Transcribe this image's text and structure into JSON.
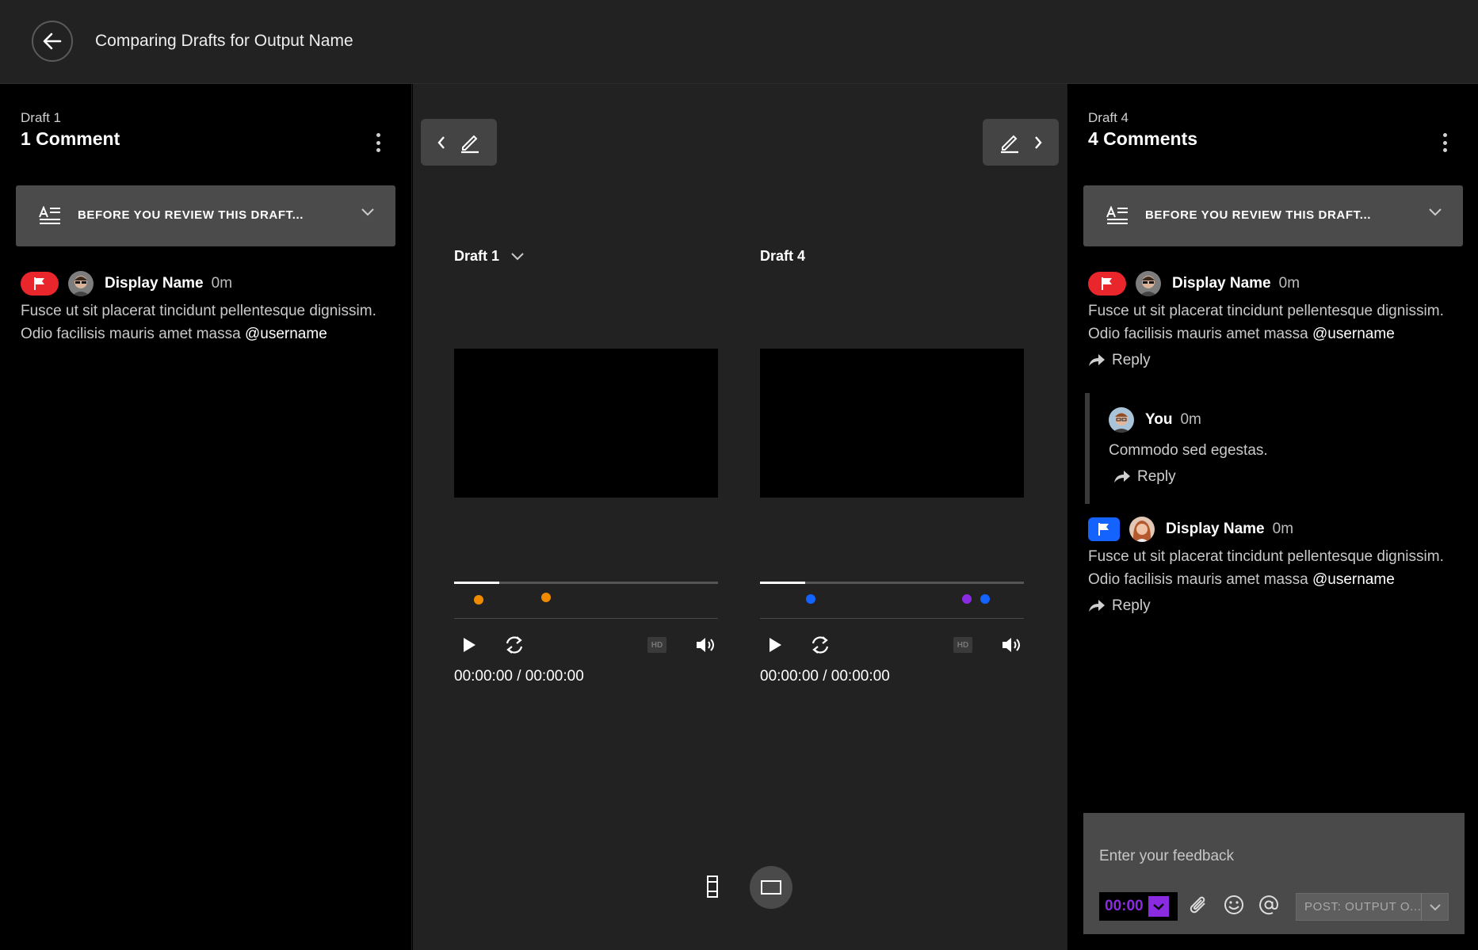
{
  "header": {
    "title": "Comparing Drafts for Output Name",
    "back_icon": "arrow-left-icon"
  },
  "left_panel": {
    "draft_label": "Draft 1",
    "comment_count_label": "1 Comment",
    "review_prompt": "BEFORE YOU REVIEW THIS DRAFT...",
    "comments": [
      {
        "flag_color": "#e8262b",
        "name": "Display Name",
        "time": "0m",
        "body": "Fusce ut sit placerat tincidunt pellentesque dignissim. Odio facilisis mauris amet massa",
        "mention": "@username"
      }
    ]
  },
  "right_panel": {
    "draft_label": "Draft 4",
    "comment_count_label": "4 Comments",
    "review_prompt": "BEFORE YOU REVIEW THIS DRAFT...",
    "comments": [
      {
        "flag_color": "#e8262b",
        "name": "Display Name",
        "time": "0m",
        "body": "Fusce ut sit placerat tincidunt pellentesque dignissim. Odio facilisis mauris amet massa",
        "mention": "@username",
        "reply_label": "Reply"
      },
      {
        "name": "You",
        "time": "0m",
        "body": "Commodo sed egestas.",
        "reply_label": "Reply"
      },
      {
        "flag_color": "#1463ff",
        "name": "Display Name",
        "time": "0m",
        "body": "Fusce ut sit placerat tincidunt pellentesque dignissim. Odio facilisis mauris amet massa",
        "mention": "@username",
        "reply_label": "Reply"
      }
    ],
    "feedback": {
      "placeholder": "Enter your feedback",
      "timecode": "00:00",
      "post_label": "POST: OUTPUT O..."
    }
  },
  "center": {
    "left_player": {
      "label": "Draft 1",
      "timestamp": "00:00:00 / 00:00:00",
      "hd_label": "HD",
      "progress": 0.17,
      "markers": [
        {
          "color": "#f08a00"
        },
        {
          "color": "#f08a00"
        }
      ]
    },
    "right_player": {
      "label": "Draft 4",
      "timestamp": "00:00:00 / 00:00:00",
      "hd_label": "HD",
      "progress": 0.17,
      "markers": [
        {
          "color": "#1463ff"
        },
        {
          "color": "#8a2be2"
        },
        {
          "color": "#1463ff"
        }
      ]
    }
  },
  "colors": {
    "header_bg": "#222222",
    "center_bg": "#222222",
    "panel_bg": "#000000",
    "accent_purple": "#8a2be2",
    "flag_red": "#e8262b",
    "flag_blue": "#1463ff",
    "marker_orange": "#f08a00"
  }
}
